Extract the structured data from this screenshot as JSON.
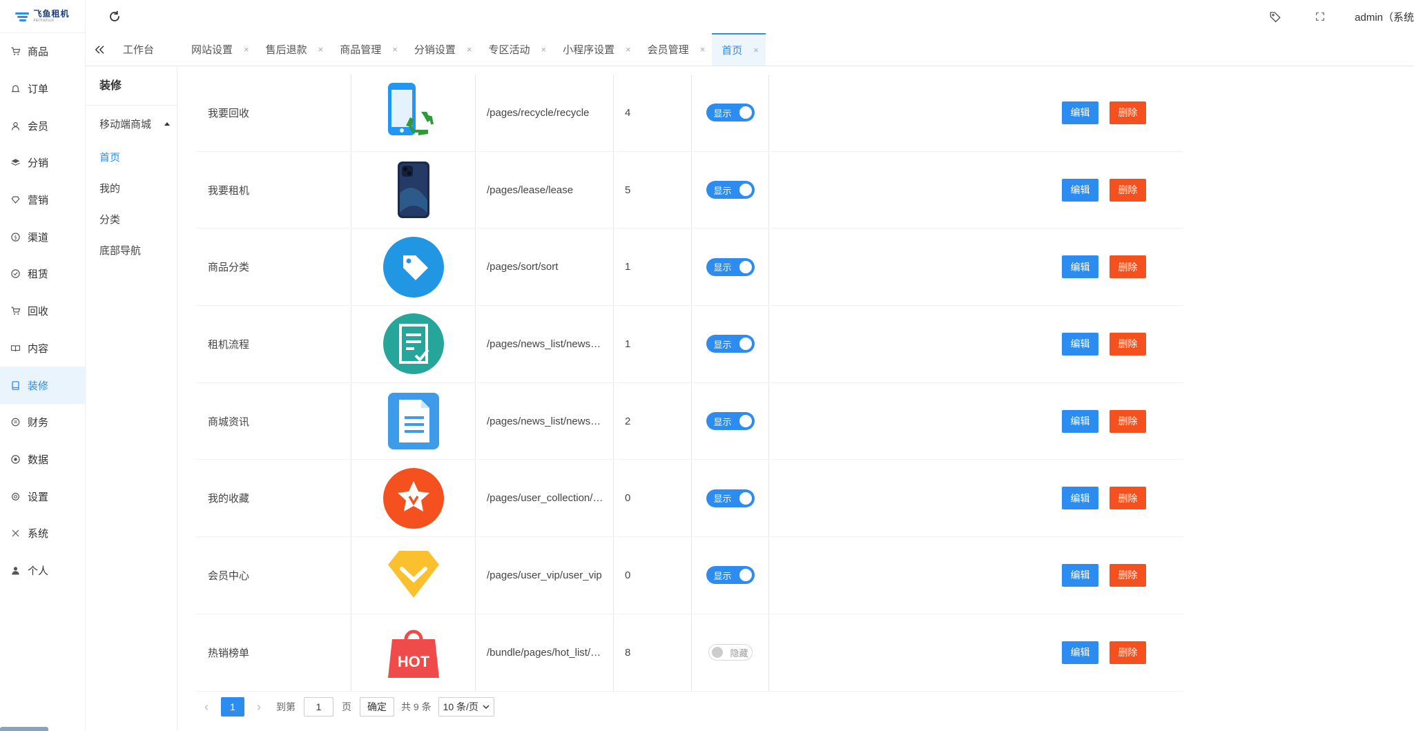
{
  "brand": {
    "logo_text": "飞鱼租机",
    "logo_sub": "FEIYUZUJI"
  },
  "sidebar": {
    "items": [
      {
        "label": "商品",
        "icon": "cart-icon"
      },
      {
        "label": "订单",
        "icon": "bell-icon"
      },
      {
        "label": "会员",
        "icon": "user-icon"
      },
      {
        "label": "分销",
        "icon": "layers-icon"
      },
      {
        "label": "营销",
        "icon": "diamond-icon"
      },
      {
        "label": "渠道",
        "icon": "coin-icon"
      },
      {
        "label": "租赁",
        "icon": "shield-check-icon"
      },
      {
        "label": "回收",
        "icon": "cart-icon"
      },
      {
        "label": "内容",
        "icon": "book-icon"
      },
      {
        "label": "装修",
        "icon": "tablet-icon",
        "active": true
      },
      {
        "label": "财务",
        "icon": "wallet-icon"
      },
      {
        "label": "数据",
        "icon": "data-icon"
      },
      {
        "label": "设置",
        "icon": "gear-icon"
      },
      {
        "label": "系统",
        "icon": "tools-icon"
      },
      {
        "label": "个人",
        "icon": "person-icon"
      }
    ]
  },
  "header": {
    "user": "admin（系统"
  },
  "tabs": [
    {
      "label": "工作台",
      "closable": false
    },
    {
      "label": "网站设置",
      "closable": true
    },
    {
      "label": "售后退款",
      "closable": true
    },
    {
      "label": "商品管理",
      "closable": true
    },
    {
      "label": "分销设置",
      "closable": true
    },
    {
      "label": "专区活动",
      "closable": true
    },
    {
      "label": "小程序设置",
      "closable": true
    },
    {
      "label": "会员管理",
      "closable": true
    },
    {
      "label": "首页",
      "closable": true,
      "active": true
    }
  ],
  "tab_close_glyph": "×",
  "submenu": {
    "title": "装修",
    "group": "移动端商城",
    "items": [
      {
        "label": "首页",
        "active": true
      },
      {
        "label": "我的"
      },
      {
        "label": "分类"
      },
      {
        "label": "底部导航"
      }
    ]
  },
  "table": {
    "edit_label": "编辑",
    "delete_label": "删除",
    "rows": [
      {
        "name": "我要回收",
        "icon": "phone-recycle-icon",
        "path": "/pages/recycle/recycle",
        "sort": "4",
        "status": "显示",
        "on": true
      },
      {
        "name": "我要租机",
        "icon": "smartphone-icon",
        "path": "/pages/lease/lease",
        "sort": "5",
        "status": "显示",
        "on": true
      },
      {
        "name": "商品分类",
        "icon": "tag-icon",
        "path": "/pages/sort/sort",
        "sort": "1",
        "status": "显示",
        "on": true
      },
      {
        "name": "租机流程",
        "icon": "checklist-icon",
        "path": "/pages/news_list/news_list",
        "sort": "1",
        "status": "显示",
        "on": true
      },
      {
        "name": "商城资讯",
        "icon": "document-icon",
        "path": "/pages/news_list/news_list",
        "sort": "2",
        "status": "显示",
        "on": true
      },
      {
        "name": "我的收藏",
        "icon": "star-icon",
        "path": "/pages/user_collection/user_collection",
        "sort": "0",
        "status": "显示",
        "on": true
      },
      {
        "name": "会员中心",
        "icon": "vip-diamond-icon",
        "path": "/pages/user_vip/user_vip",
        "sort": "0",
        "status": "显示",
        "on": true
      },
      {
        "name": "热销榜单",
        "icon": "hot-bag-icon",
        "path": "/bundle/pages/hot_list/hot_list",
        "sort": "8",
        "status": "隐藏",
        "on": false
      }
    ]
  },
  "pager": {
    "current": "1",
    "goto_label": "到第",
    "goto_value": "1",
    "page_unit": "页",
    "confirm": "确定",
    "total": "共 9 条",
    "page_size": "10 条/页"
  },
  "colors": {
    "accent": "#2d8cf0",
    "danger": "#f4511e"
  }
}
